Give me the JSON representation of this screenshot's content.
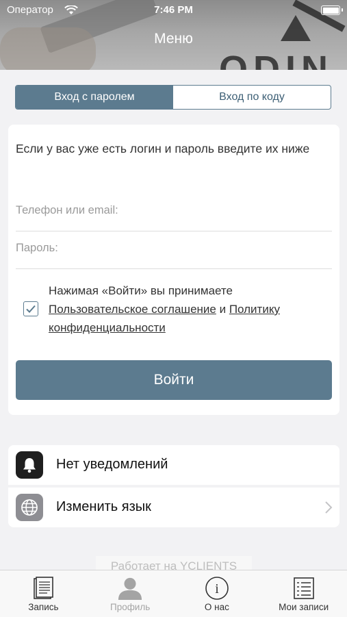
{
  "status_bar": {
    "carrier": "Оператор",
    "time": "7:46 PM",
    "battery_level": 1.0
  },
  "header": {
    "title": "Меню",
    "logo_text": "ODIN"
  },
  "login_tabs": [
    {
      "label": "Вход с паролем",
      "active": true
    },
    {
      "label": "Вход по коду",
      "active": false
    }
  ],
  "login": {
    "intro": "Если у вас уже есть логин и пароль введите их ниже",
    "phone_placeholder": "Телефон или email:",
    "phone_value": "",
    "password_placeholder": "Пароль:",
    "password_value": "",
    "agreement_checked": true,
    "agreement_prefix": "Нажимая «Войти» вы принимаете",
    "agreement_link1": "Пользовательское соглашение",
    "agreement_and": "и",
    "agreement_link2": "Политику конфиденциальности",
    "submit_label": "Войти"
  },
  "menu": [
    {
      "label": "Нет уведомлений",
      "icon": "bell-icon"
    },
    {
      "label": "Изменить язык",
      "icon": "globe-icon"
    }
  ],
  "powered_by": "Работает на YCLIENTS",
  "tabbar": [
    {
      "label": "Запись",
      "icon": "document-icon"
    },
    {
      "label": "Профиль",
      "icon": "person-icon"
    },
    {
      "label": "О нас",
      "icon": "info-icon"
    },
    {
      "label": "Мои записи",
      "icon": "list-icon"
    }
  ],
  "colors": {
    "accent": "#5c7b8f",
    "background": "#f2f2f4"
  }
}
